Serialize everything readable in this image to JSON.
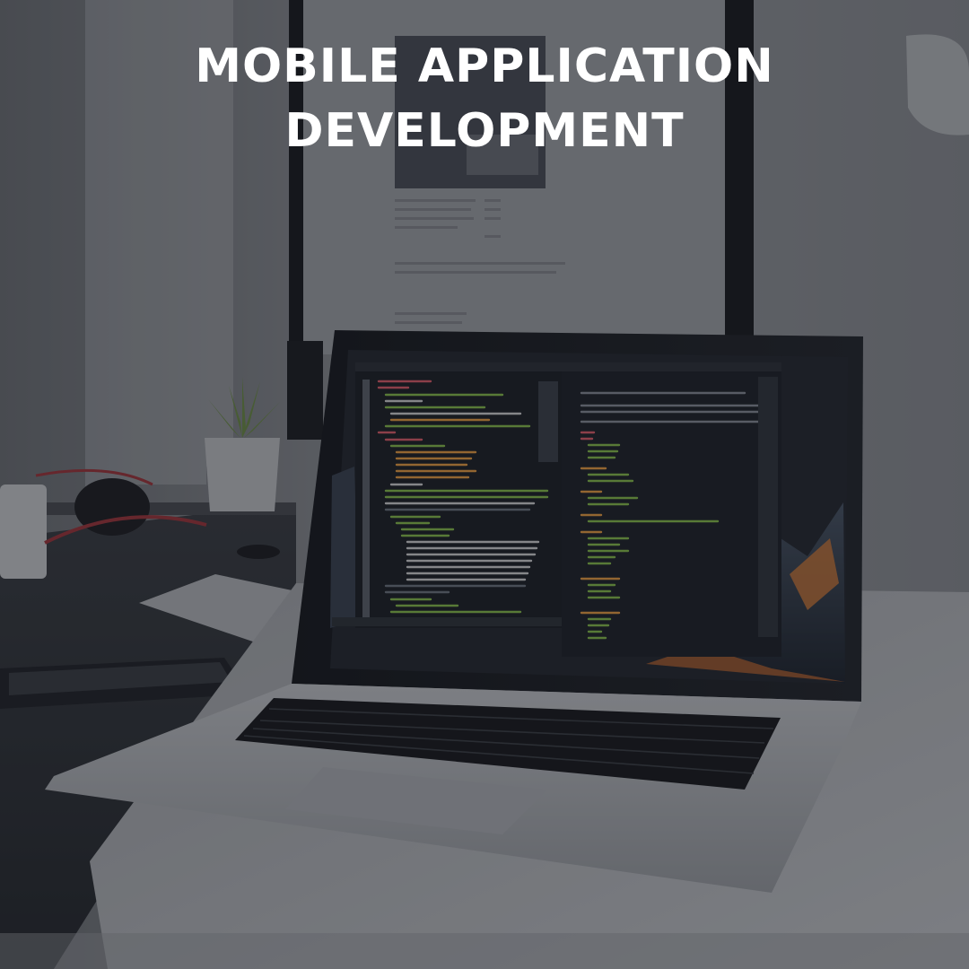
{
  "headline": {
    "line1": "MOBILE  APPLICATION",
    "line2": "DEVELOPMENT"
  },
  "palette": {
    "wall": "#8a8d91",
    "desk_dark": "#2b2e33",
    "laptop_silver": "#b9bcc0",
    "screen_bg": "#1b1e24",
    "code_green": "#8bc34a",
    "code_orange": "#f0a040",
    "code_red": "#e35d6a",
    "code_blue": "#6fb3e0",
    "code_white": "#d8d8d8"
  }
}
